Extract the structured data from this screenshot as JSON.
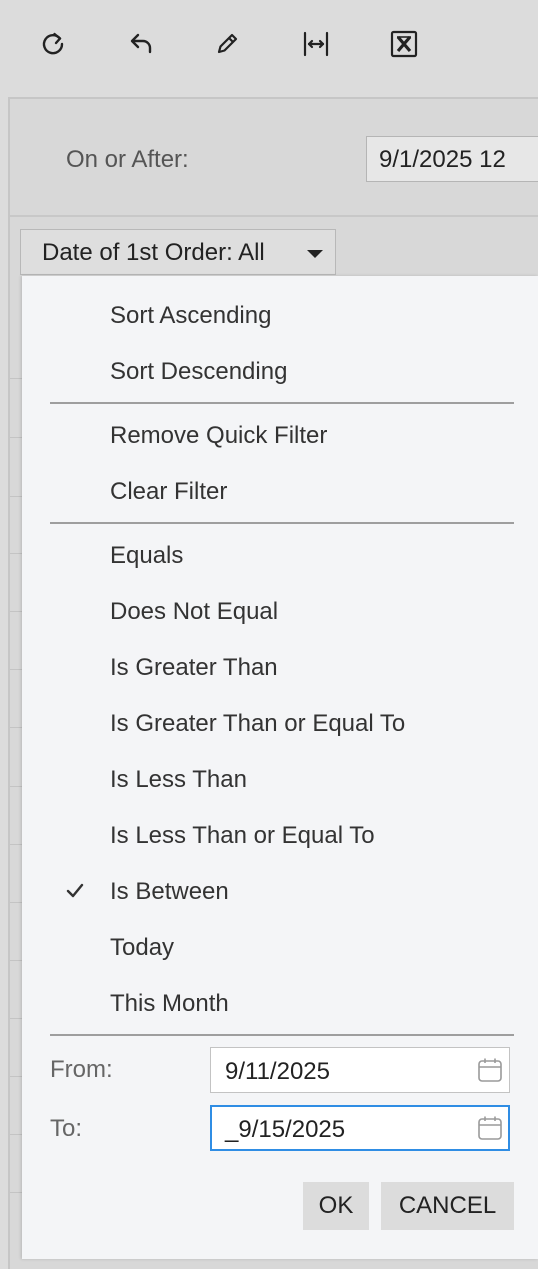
{
  "toolbar": {
    "icons": [
      "refresh-icon",
      "undo-icon",
      "edit-icon",
      "fit-width-icon",
      "excel-export-icon"
    ]
  },
  "filter_bar": {
    "on_or_after_label": "On or After:",
    "on_or_after_value": "9/1/2025 12",
    "column_filter_label": "Date of 1st Order: All"
  },
  "menu": {
    "sort_ascending": "Sort Ascending",
    "sort_descending": "Sort Descending",
    "remove_quick_filter": "Remove Quick Filter",
    "clear_filter": "Clear Filter",
    "conditions": [
      "Equals",
      "Does Not Equal",
      "Is Greater Than",
      "Is Greater Than or Equal To",
      "Is Less Than",
      "Is Less Than or Equal To",
      "Is Between",
      "Today",
      "This Month"
    ],
    "selected_condition": "Is Between",
    "from_label": "From:",
    "from_value": "9/11/2025",
    "to_label": "To:",
    "to_value": "_9/15/2025",
    "ok_label": "OK",
    "cancel_label": "CANCEL"
  }
}
